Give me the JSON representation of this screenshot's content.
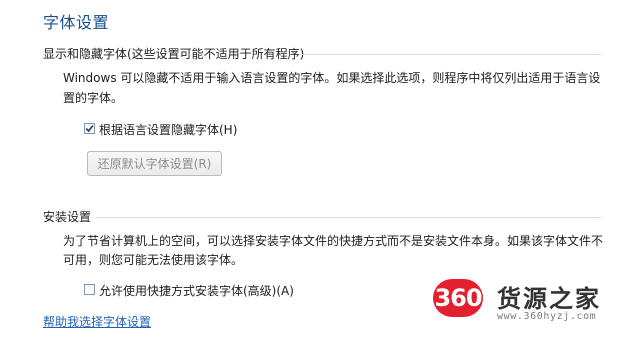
{
  "page": {
    "title": "字体设置"
  },
  "hide_fonts_section": {
    "label": "显示和隐藏字体(这些设置可能不适用于所有程序)",
    "description_line1": "Windows 可以隐藏不适用于输入语言设置的字体。如果选择此选项，则程序中将仅列出适用于语言设",
    "description_line2": "置的字体。",
    "checkbox_label": "根据语言设置隐藏字体(H)",
    "checkbox_checked": true,
    "restore_button_label": "还原默认字体设置(R)"
  },
  "install_section": {
    "label": "安装设置",
    "description_line1": "为了节省计算机上的空间，可以选择安装字体文件的快捷方式而不是安装文件本身。如果该字体文件不",
    "description_line2": "可用，则您可能无法使用该字体。",
    "checkbox_label": "允许使用快捷方式安装字体(高级)(A)",
    "checkbox_checked": false
  },
  "help_link": "帮助我选择字体设置",
  "watermark": {
    "badge": "360",
    "name": "货源之家",
    "url": "www.360hyzj.com"
  },
  "colors": {
    "title": "#1a4f8e",
    "link": "#1f63b5",
    "watermark_badge": "#e5202e"
  }
}
